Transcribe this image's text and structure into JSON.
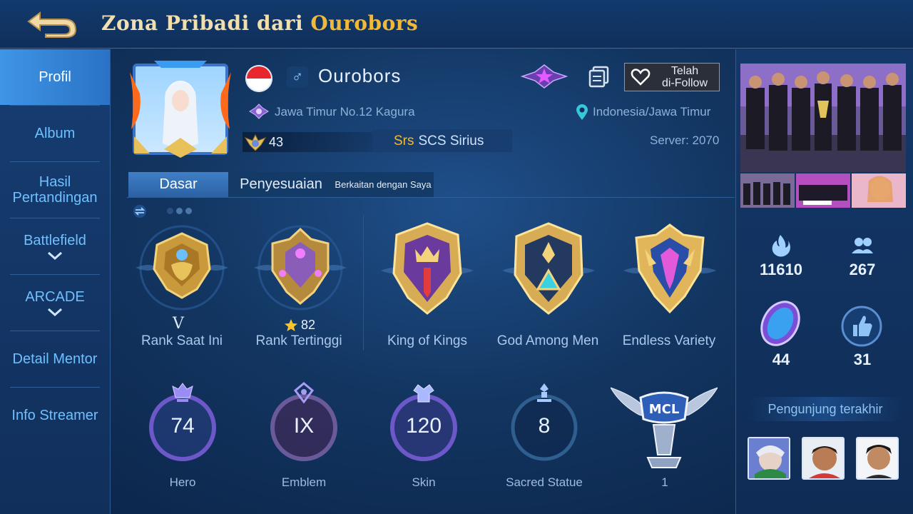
{
  "header": {
    "title_prefix": "Zona Pribadi dari ",
    "title_name": "Ourobors"
  },
  "sidebar": {
    "items": [
      {
        "label": "Profil",
        "active": true
      },
      {
        "label": "Album"
      },
      {
        "label": "Hasil\nPertandingan"
      },
      {
        "label": "Battlefield"
      },
      {
        "label": "ARCADE"
      },
      {
        "label": "Detail Mentor"
      },
      {
        "label": "Info Streamer"
      }
    ]
  },
  "profile": {
    "name": "Ourobors",
    "gender_symbol": "♂",
    "rank_title": "Jawa Timur No.12 Kagura",
    "location": "Indonesia/Jawa Timur",
    "level": "43",
    "squad_tag": "Srs",
    "squad_name": "SCS Sirius",
    "server": "Server: 2070",
    "follow_label": "Telah\ndi-Follow"
  },
  "tabs": [
    {
      "label": "Dasar",
      "active": true
    },
    {
      "label": "Penyesuaian"
    },
    {
      "label": "Berkaitan dengan Saya"
    }
  ],
  "medals": [
    {
      "label": "Rank Saat Ini",
      "sub": "V"
    },
    {
      "label": "Rank Tertinggi",
      "sub": "82",
      "sub_icon": "star-icon"
    },
    {
      "label": "King of Kings"
    },
    {
      "label": "God Among Men"
    },
    {
      "label": "Endless Variety"
    }
  ],
  "stats": [
    {
      "label": "Hero",
      "value": "74",
      "icon": "hero-icon"
    },
    {
      "label": "Emblem",
      "value": "IX",
      "icon": "emblem-icon"
    },
    {
      "label": "Skin",
      "value": "120",
      "icon": "skin-icon"
    },
    {
      "label": "Sacred Statue",
      "value": "8",
      "icon": "statue-icon"
    },
    {
      "label": "1",
      "value": "",
      "icon": "mcl-trophy-icon"
    }
  ],
  "right_panel": {
    "popularity": "11610",
    "friends": "267",
    "charm": "44",
    "likes": "31",
    "visitors_title": "Pengunjung terakhir"
  },
  "colors": {
    "accent_gold": "#f0b93a",
    "active_blue": "#3f95e6",
    "text_blue": "#6fc0ff"
  }
}
